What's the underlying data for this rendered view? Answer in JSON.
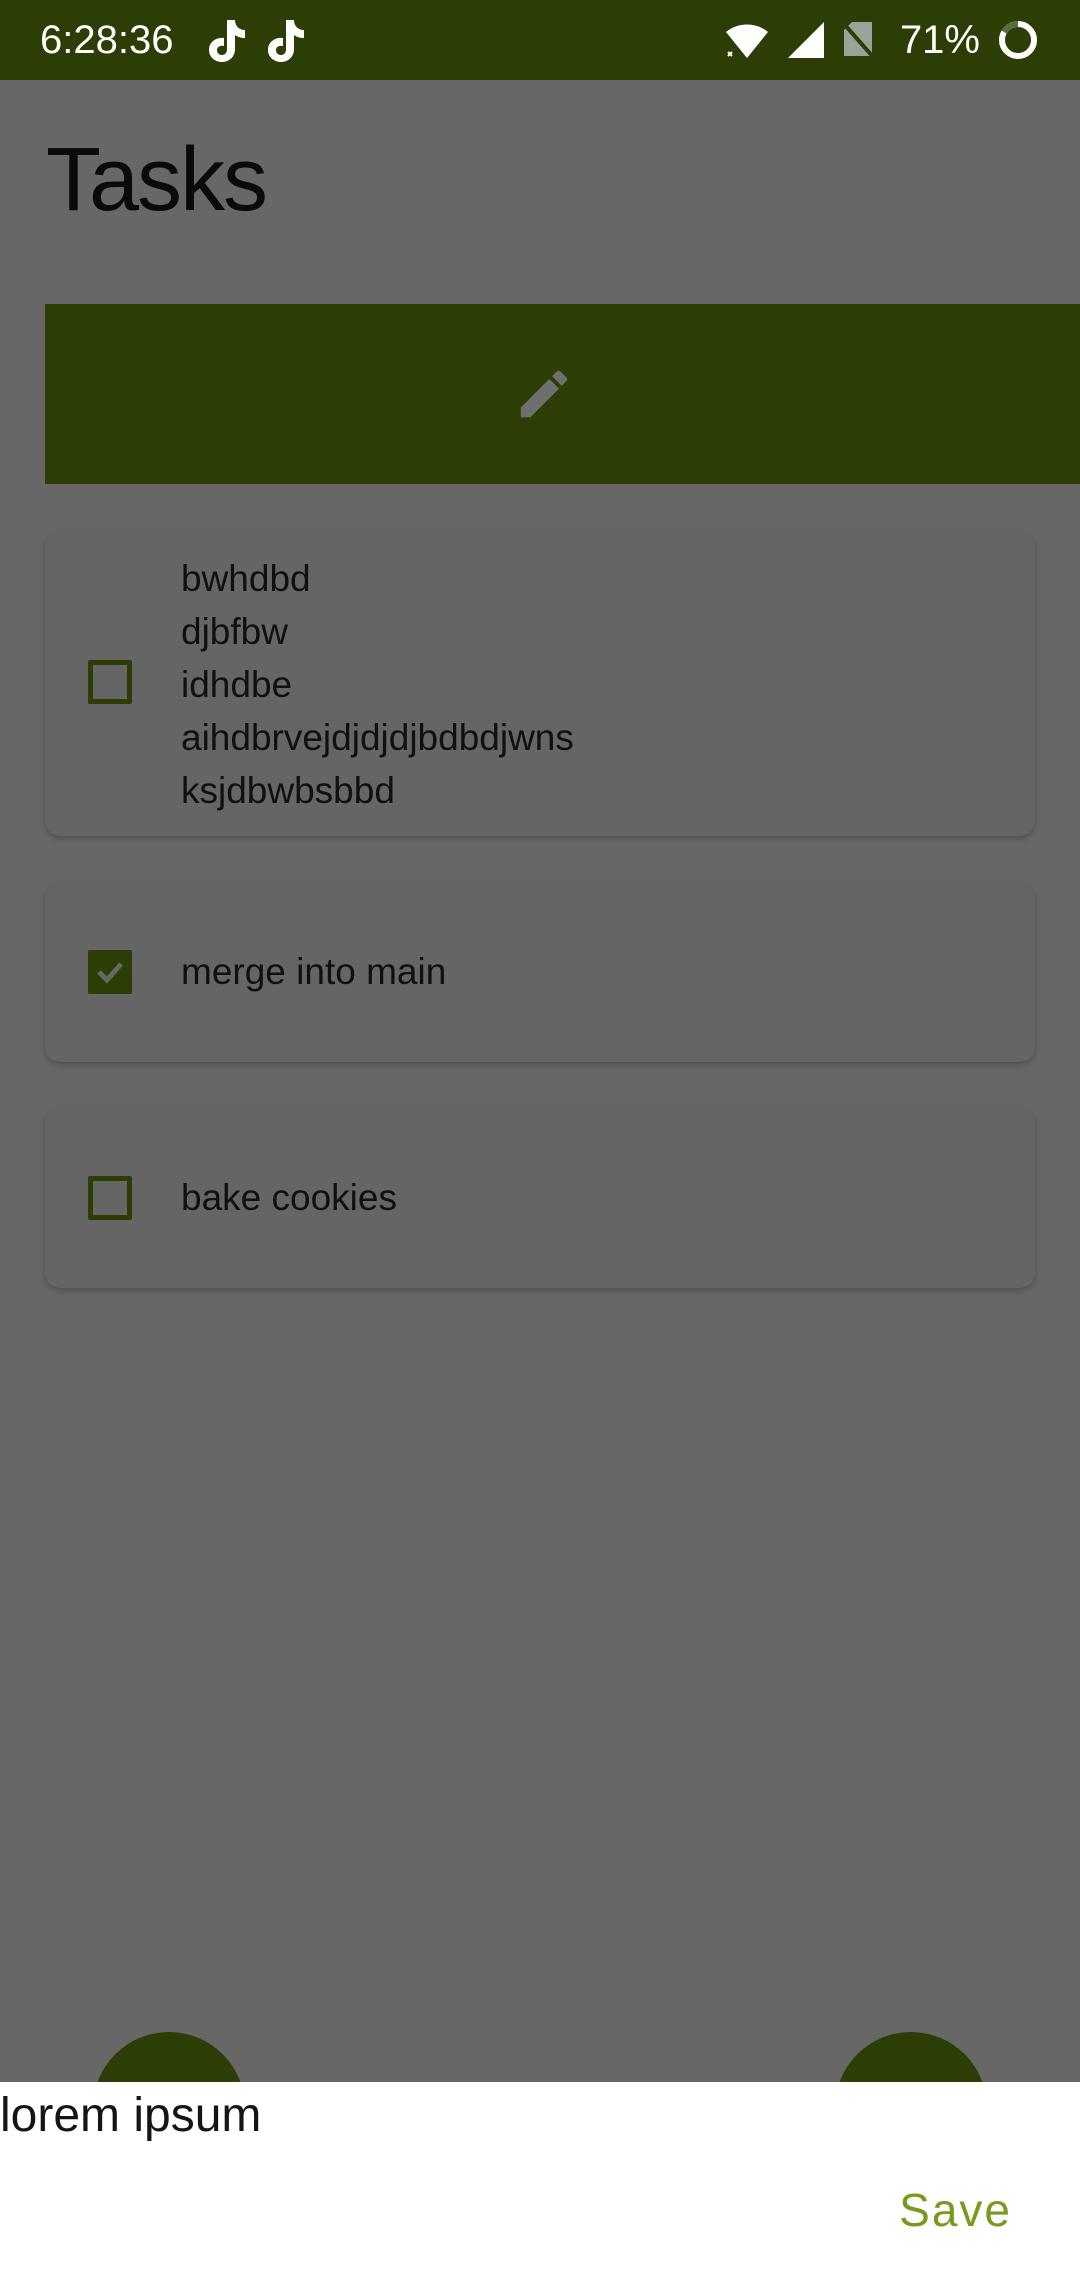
{
  "status_bar": {
    "time": "6:28:36",
    "notification_icons": [
      "tiktok-icon",
      "tiktok-icon"
    ],
    "wifi_icon": "wifi-icon",
    "signal_icon": "cell-signal-icon",
    "sim_icon": "no-sim-icon",
    "battery": "71%",
    "battery_icon": "battery-ring-icon"
  },
  "page": {
    "title": "Tasks"
  },
  "edit_bar": {
    "icon": "pencil-icon"
  },
  "tasks": [
    {
      "lines": [
        "bwhdbd",
        "djbfbw",
        "idhdbe",
        "aihdbrvejdjdjdjbdbdjwns",
        "ksjdbwbsbbd"
      ],
      "checked": false
    },
    {
      "lines": [
        "merge into main"
      ],
      "checked": true
    },
    {
      "lines": [
        "bake cookies"
      ],
      "checked": false
    }
  ],
  "bottom_sheet": {
    "input_value": "lorem ipsum",
    "save_label": "Save"
  },
  "colors": {
    "primary": "#2c3e05",
    "scrim_background": "#676767",
    "accent_text": "#7a9a1e",
    "sheet_background": "#ffffff"
  }
}
